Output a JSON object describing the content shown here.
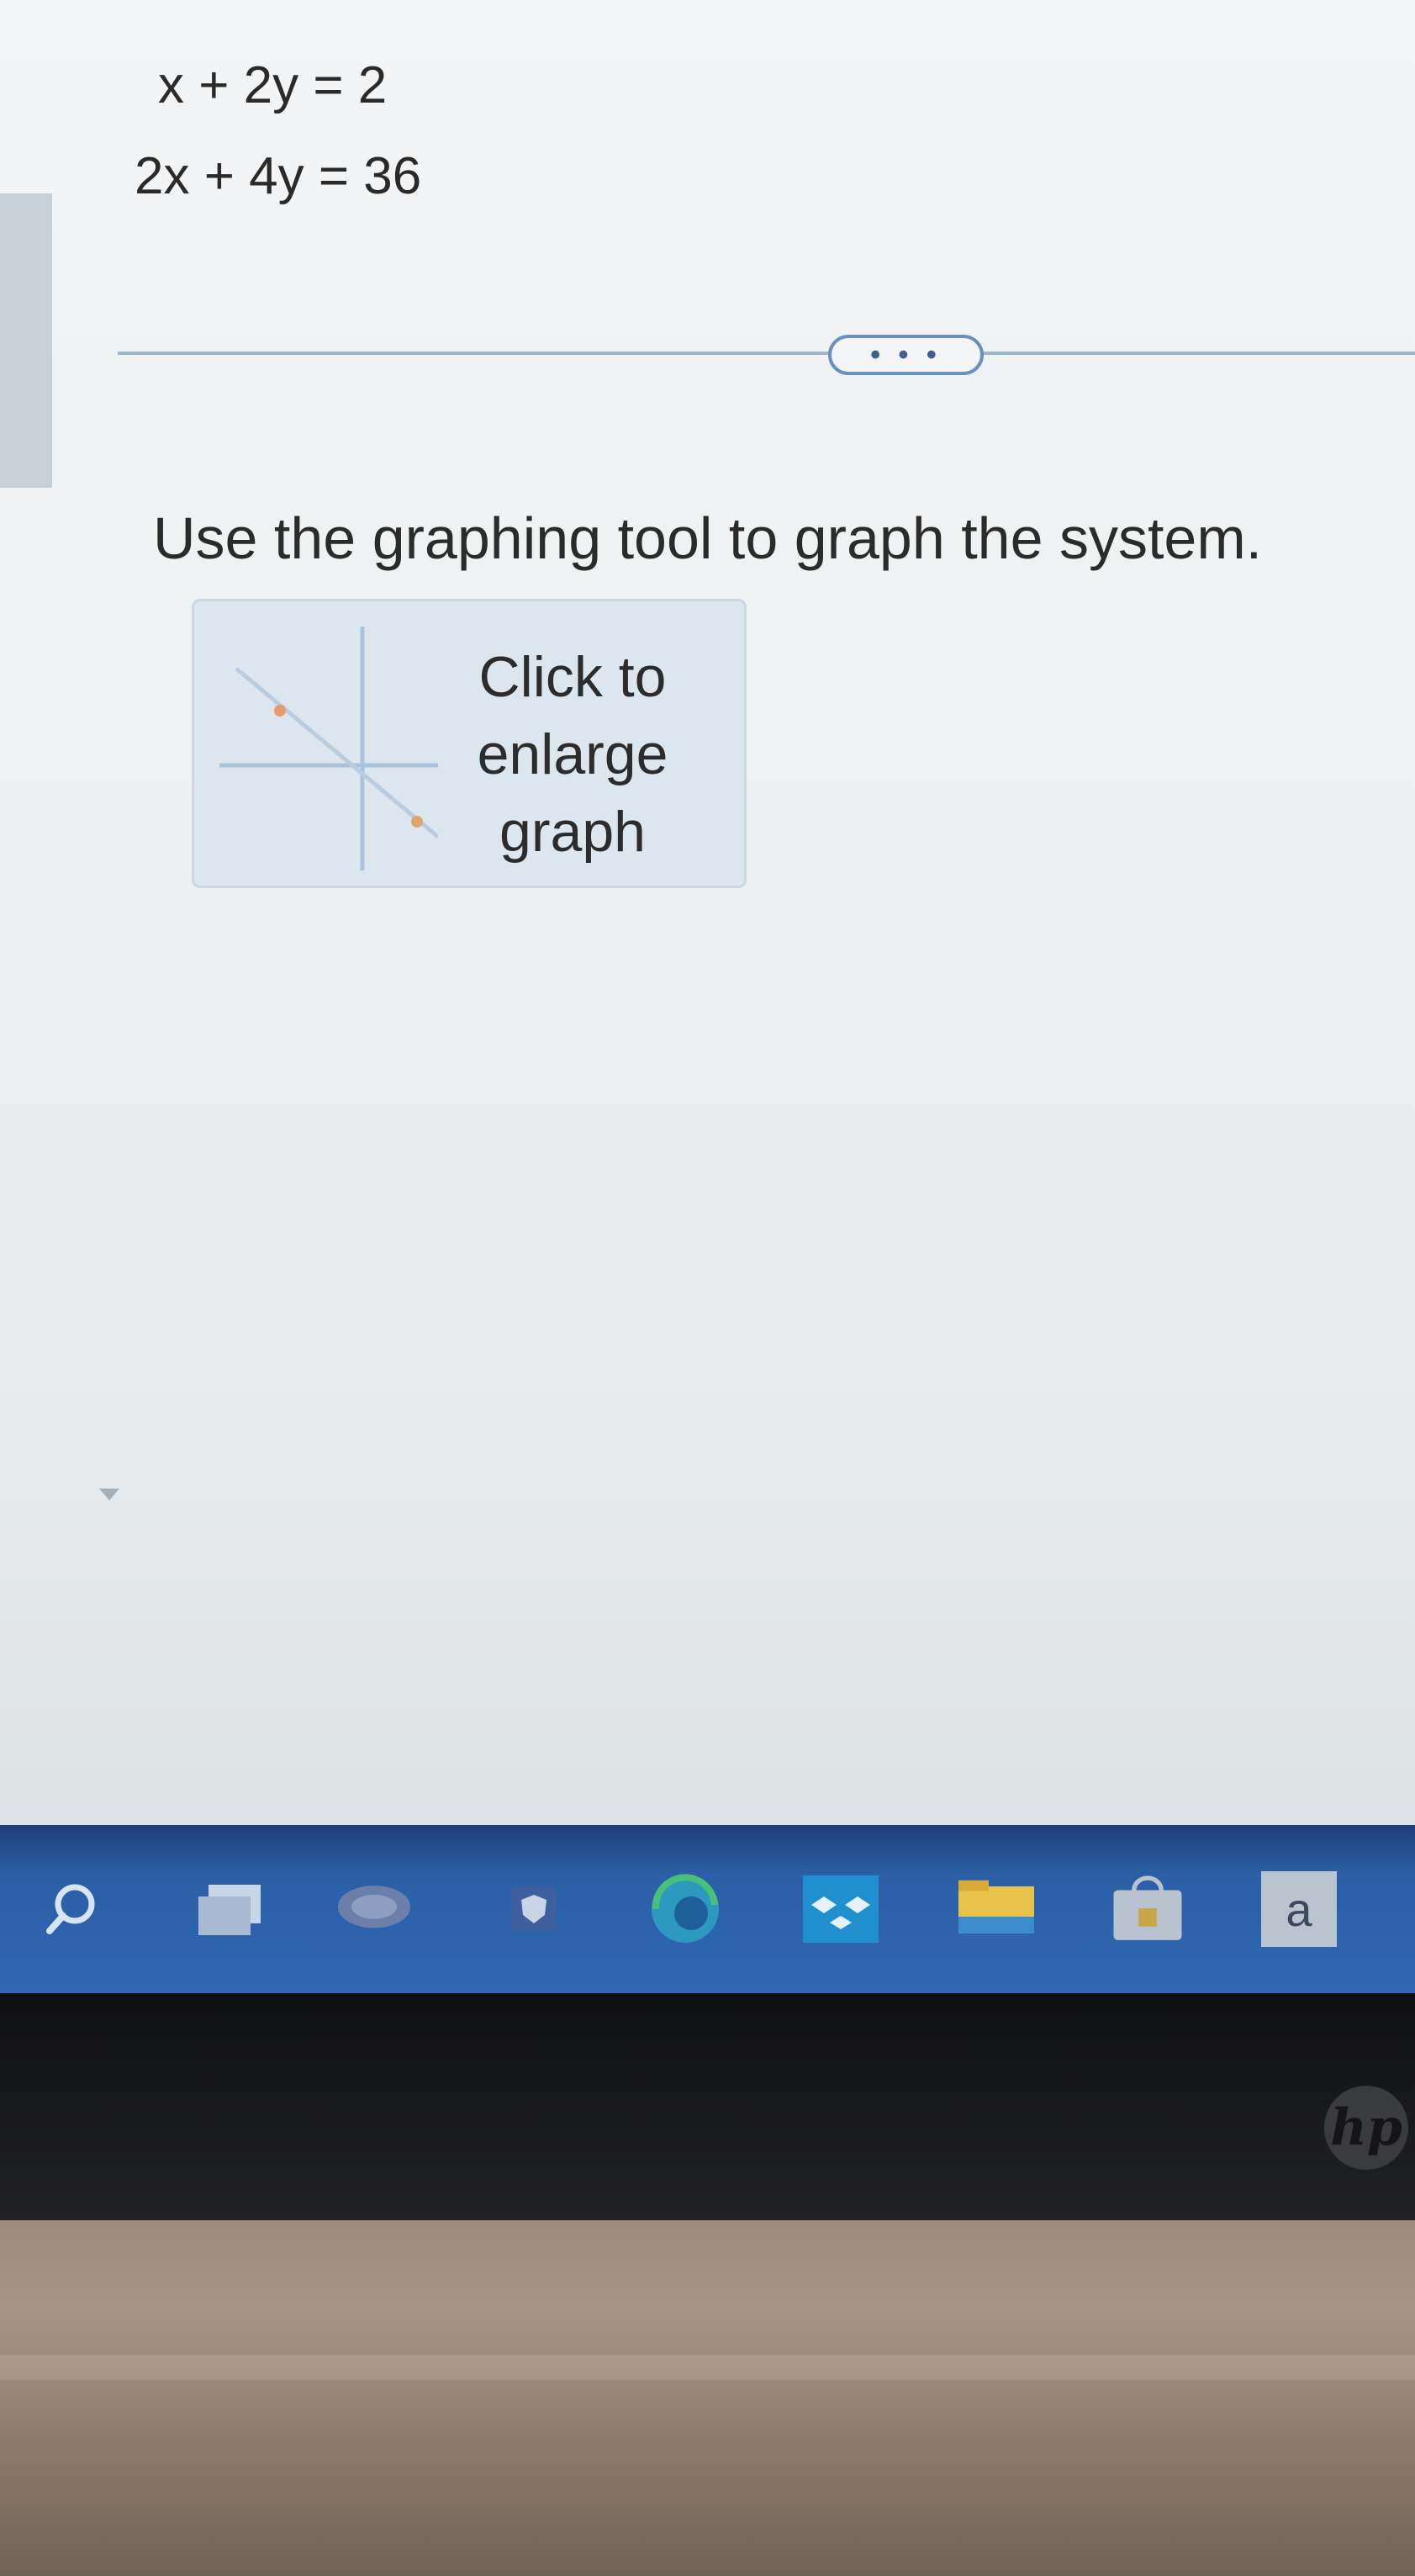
{
  "equations": {
    "line1": "x + 2y = 2",
    "line2": "2x + 4y = 36"
  },
  "more_button": {
    "label": "• • •"
  },
  "instruction": "Use the graphing tool to graph the system.",
  "graph_button": {
    "label_line1": "Click to",
    "label_line2": "enlarge",
    "label_line3": "graph"
  },
  "taskbar": {
    "icons": [
      "search-icon",
      "task-view-icon",
      "chat-icon",
      "security-shield-icon",
      "edge-browser-icon",
      "dropbox-icon",
      "file-explorer-icon",
      "store-icon",
      "text-app-icon"
    ],
    "text_app_label": "a"
  },
  "device": {
    "logo_text": "hp"
  },
  "colors": {
    "accent": "#2f67b3",
    "divider": "#9fb6d0",
    "button_border": "#6b8fc1"
  }
}
